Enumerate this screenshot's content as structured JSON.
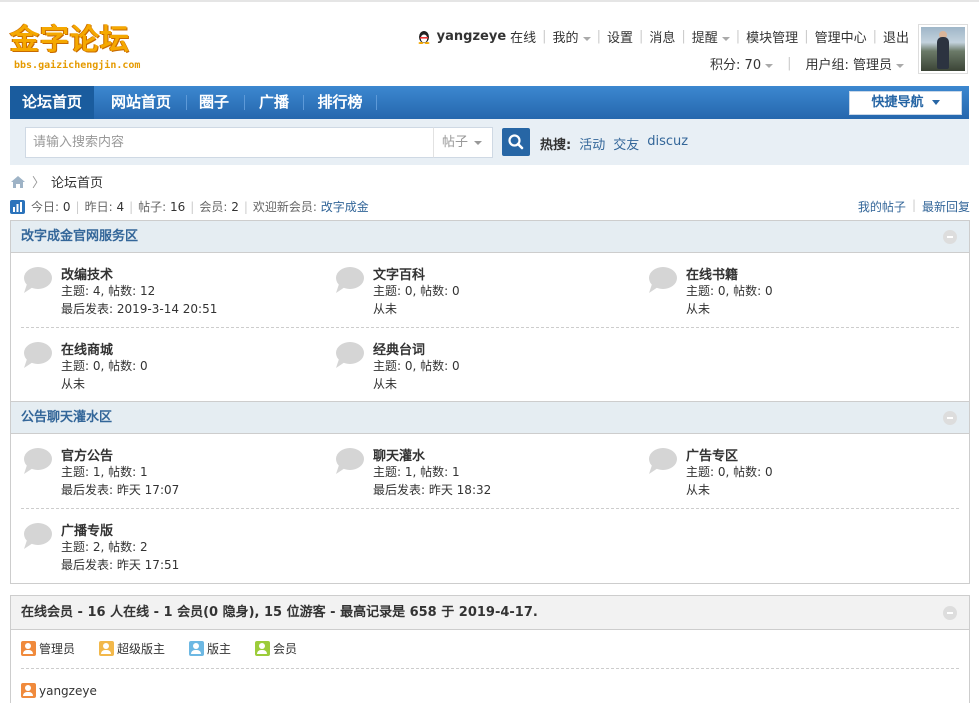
{
  "logo": {
    "title": "金字论坛",
    "url_text": "bbs.gaizichengjin.com"
  },
  "userbar": {
    "username": "yangzeye",
    "status": "在线",
    "links": [
      "我的",
      "设置",
      "消息",
      "提醒",
      "模块管理",
      "管理中心",
      "退出"
    ],
    "points_label": "积分: 70",
    "group_label": "用户组: 管理员"
  },
  "nav": {
    "items": [
      "论坛首页",
      "网站首页",
      "圈子",
      "广播",
      "排行榜"
    ],
    "quick_nav": "快捷导航"
  },
  "search": {
    "placeholder": "请输入搜索内容",
    "type": "帖子",
    "hot_label": "热搜:",
    "hot_keywords": [
      "活动",
      "交友",
      "discuz"
    ]
  },
  "breadcrumb": {
    "current": "论坛首页"
  },
  "stats": {
    "today_label": "今日:",
    "today": "0",
    "yesterday_label": "昨日:",
    "yesterday": "4",
    "posts_label": "帖子:",
    "posts": "16",
    "members_label": "会员:",
    "members": "2",
    "newest_label": "欢迎新会员:",
    "newest": "改字成金"
  },
  "right_links": {
    "my_posts": "我的帖子",
    "latest": "最新回复"
  },
  "sections": [
    {
      "title": "改字成金官网服务区",
      "forums": [
        {
          "name": "改编技术",
          "counts": "主题: 4, 帖数: 12",
          "last": "最后发表: 2019-3-14 20:51"
        },
        {
          "name": "文字百科",
          "counts": "主题: 0, 帖数: 0",
          "last": "从未"
        },
        {
          "name": "在线书籍",
          "counts": "主题: 0, 帖数: 0",
          "last": "从未"
        },
        {
          "name": "在线商城",
          "counts": "主题: 0, 帖数: 0",
          "last": "从未"
        },
        {
          "name": "经典台词",
          "counts": "主题: 0, 帖数: 0",
          "last": "从未"
        }
      ]
    },
    {
      "title": "公告聊天灌水区",
      "forums": [
        {
          "name": "官方公告",
          "counts": "主题: 1, 帖数: 1",
          "last": "最后发表: 昨天 17:07"
        },
        {
          "name": "聊天灌水",
          "counts": "主题: 1, 帖数: 1",
          "last": "最后发表: 昨天 18:32"
        },
        {
          "name": "广告专区",
          "counts": "主题: 0, 帖数: 0",
          "last": "从未"
        },
        {
          "name": "广播专版",
          "counts": "主题: 2, 帖数: 2",
          "last": "最后发表: 昨天 17:51"
        }
      ]
    }
  ],
  "online": {
    "title": "在线会员 - 16 人在线 - 1 会员(0 隐身), 15 位游客 - 最高记录是 658 于 2019-4-17.",
    "legend": [
      {
        "label": "管理员",
        "color": "#f08a3c"
      },
      {
        "label": "超级版主",
        "color": "#f2b84b"
      },
      {
        "label": "版主",
        "color": "#6db8e3"
      },
      {
        "label": "会员",
        "color": "#9ccc3a"
      }
    ],
    "users": [
      "yangzeye"
    ]
  },
  "colors": {
    "nav": "#2b73bb",
    "link": "#336699",
    "section_header": "#e5edf2"
  }
}
